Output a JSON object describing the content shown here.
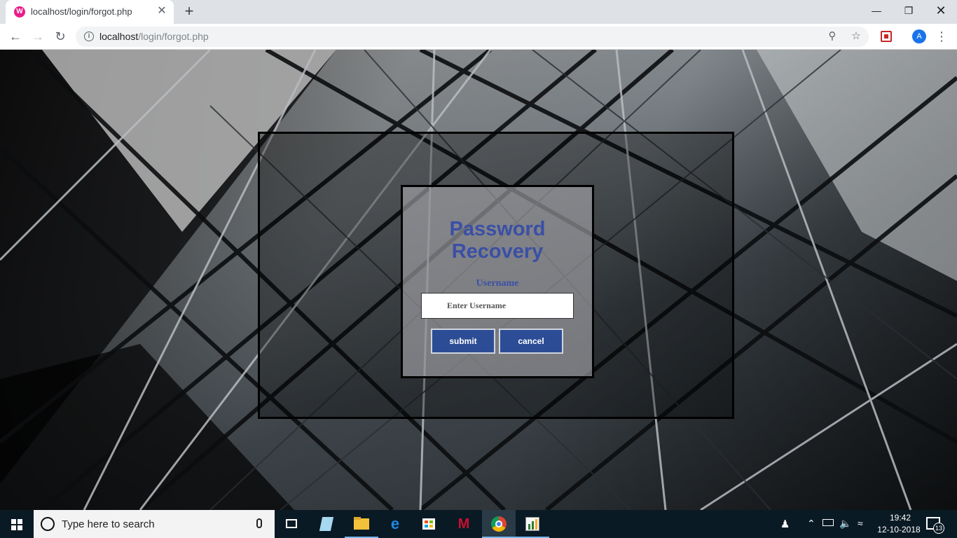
{
  "browser": {
    "tab_title": "localhost/login/forgot.php",
    "favicon_letter": "W",
    "url_host": "localhost",
    "url_path": "/login/forgot.php",
    "avatar_letter": "A"
  },
  "form": {
    "title_line1": "Password",
    "title_line2": "Recovery",
    "username_label": "Username",
    "username_placeholder": "Enter Username",
    "username_value": "",
    "submit_label": "submit",
    "cancel_label": "cancel",
    "accent_color": "#3a4fa6",
    "button_color": "#2c4d96"
  },
  "taskbar": {
    "search_placeholder": "Type here to search",
    "time": "19:42",
    "date": "12-10-2018",
    "notification_count": "13"
  }
}
